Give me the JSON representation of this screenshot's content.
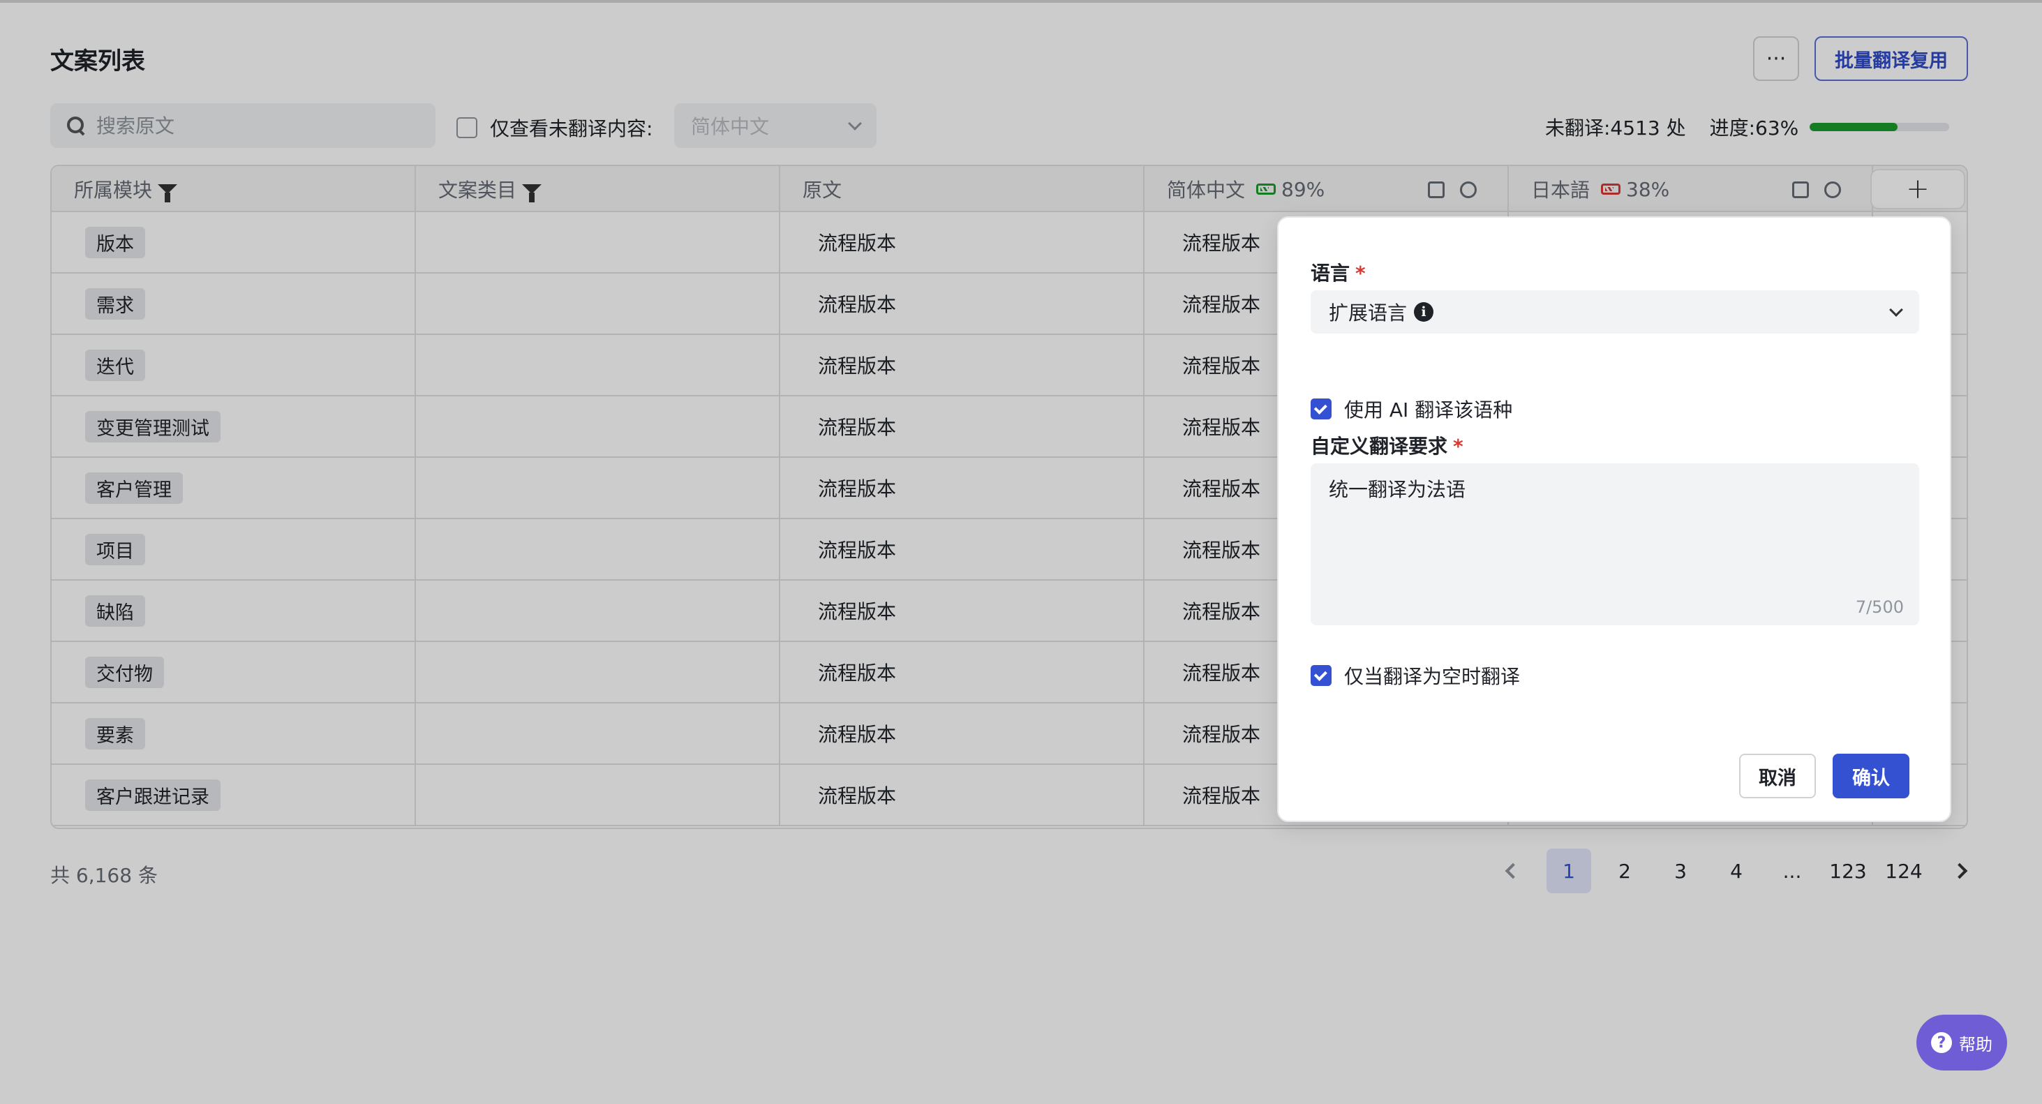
{
  "header": {
    "title": "文案列表",
    "more_label": "···",
    "bulk_label": "批量翻译复用"
  },
  "toolbar": {
    "search_placeholder": "搜索原文",
    "untranslated_only_label": "仅查看未翻译内容:",
    "language_select_value": "简体中文",
    "untranslated_count_text": "未翻译:4513 处",
    "progress_text": "进度:63%",
    "progress_value": 0.63
  },
  "table": {
    "columns": {
      "module": "所属模块",
      "category": "文案类目",
      "source": "原文",
      "zh": "简体中文",
      "zh_pct": "89%",
      "ja": "日本語",
      "ja_pct": "38%",
      "add": "+"
    },
    "rows": [
      {
        "module": "版本",
        "source": "流程版本",
        "zh": "流程版本"
      },
      {
        "module": "需求",
        "source": "流程版本",
        "zh": "流程版本"
      },
      {
        "module": "迭代",
        "source": "流程版本",
        "zh": "流程版本"
      },
      {
        "module": "变更管理测试",
        "source": "流程版本",
        "zh": "流程版本"
      },
      {
        "module": "客户管理",
        "source": "流程版本",
        "zh": "流程版本"
      },
      {
        "module": "项目",
        "source": "流程版本",
        "zh": "流程版本"
      },
      {
        "module": "缺陷",
        "source": "流程版本",
        "zh": "流程版本"
      },
      {
        "module": "交付物",
        "source": "流程版本",
        "zh": "流程版本"
      },
      {
        "module": "要素",
        "source": "流程版本",
        "zh": "流程版本"
      },
      {
        "module": "客户跟进记录",
        "source": "流程版本",
        "zh": "流程版本"
      }
    ]
  },
  "footer": {
    "total_text": "共 6,168 条",
    "pages": [
      "1",
      "2",
      "3",
      "4",
      "...",
      "123",
      "124"
    ],
    "active_page": "1"
  },
  "popover": {
    "language_label": "语言",
    "required_mark": "*",
    "language_value": "扩展语言",
    "info_glyph": "i",
    "use_ai_label": "使用 AI 翻译该语种",
    "use_ai_checked": true,
    "custom_req_label": "自定义翻译要求",
    "custom_req_value": "统一翻译为法语",
    "counter": "7/500",
    "only_empty_label": "仅当翻译为空时翻译",
    "only_empty_checked": true,
    "cancel_label": "取消",
    "confirm_label": "确认"
  },
  "help": {
    "icon_glyph": "?",
    "label": "帮助"
  },
  "colors": {
    "primary": "#3451d1",
    "progress": "#1a9c2c",
    "danger": "#d83931",
    "help": "#6f5dd6"
  }
}
